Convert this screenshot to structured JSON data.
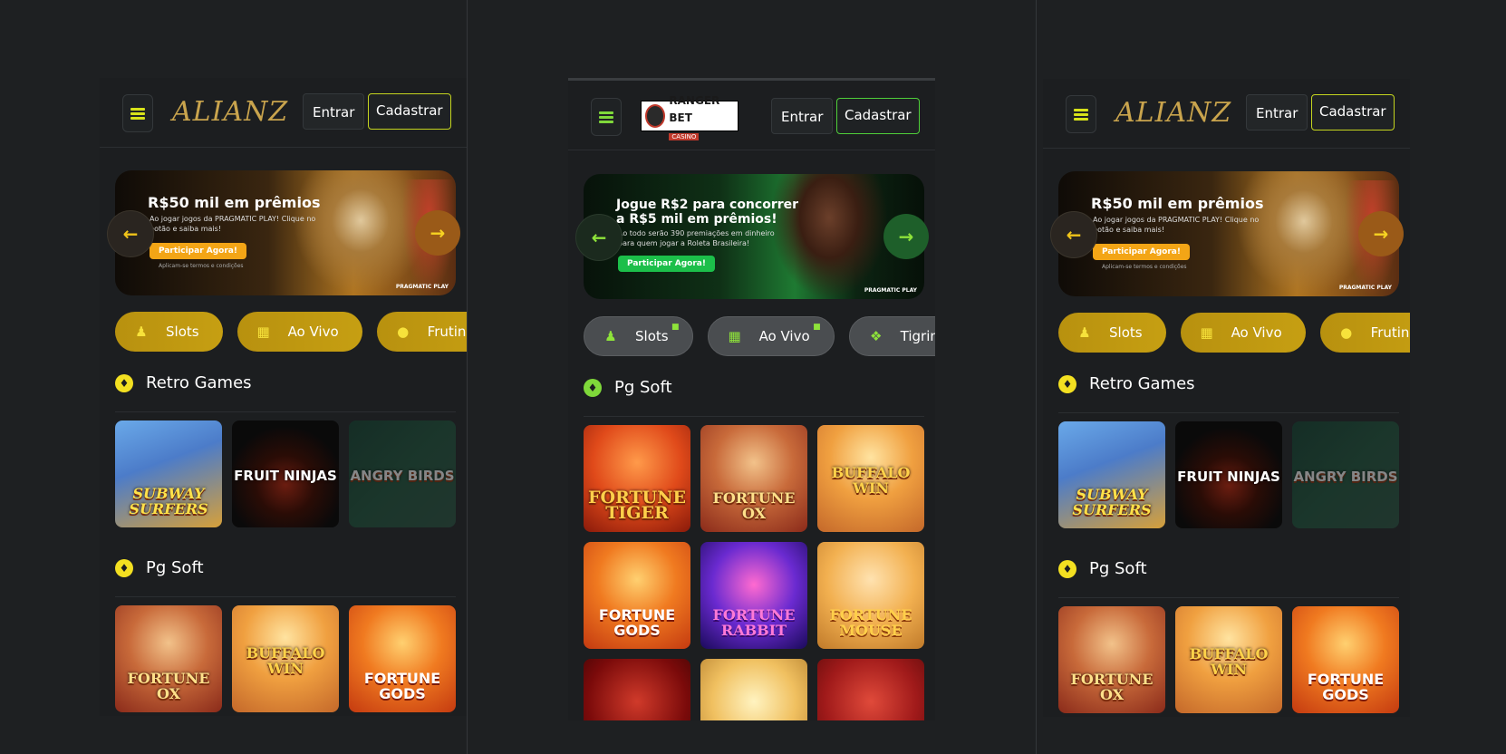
{
  "colors": {
    "bg": "#1e2022",
    "accent_gold": "#d7e21a",
    "accent_green": "#8ee33a",
    "cat_gold": "#c69f12"
  },
  "screens": {
    "left": {
      "logo": "ALIANZ",
      "header": {
        "login": "Entrar",
        "register": "Cadastrar"
      },
      "banner": {
        "title": "R$50 mil em prêmios",
        "subtitle": "Ao jogar jogos da PRAGMATIC PLAY! Clique no botão e saiba mais!",
        "cta": "Participar Agora!",
        "terms": "Aplicam-se termos e condições",
        "brand": "PRAGMATIC PLAY"
      },
      "categories": [
        "Slots",
        "Ao Vivo",
        "Frutin"
      ],
      "sections": [
        {
          "title": "Retro Games",
          "games": [
            "SUBWAY SURFERS",
            "FRUIT NINJAS",
            "ANGRY BIRDS"
          ]
        },
        {
          "title": "Pg Soft",
          "games": [
            "FORTUNE OX",
            "BUFFALO WIN",
            "FORTUNE GODS"
          ]
        }
      ]
    },
    "middle": {
      "logo": "RANGER BET",
      "logo_sub": "CASINO",
      "header": {
        "login": "Entrar",
        "register": "Cadastrar"
      },
      "banner": {
        "title": "Jogue R$2 para concorrer a R$5 mil em prêmios!",
        "subtitle": "Ao todo serão 390 premiações em dinheiro para quem jogar a Roleta Brasileira!",
        "cta": "Participar Agora!",
        "brand": "PRAGMATIC PLAY"
      },
      "categories": [
        "Slots",
        "Ao Vivo",
        "Tigrin"
      ],
      "section_title": "Pg Soft",
      "games": [
        "FORTUNE TIGER",
        "FORTUNE OX",
        "BUFFALO WIN",
        "FORTUNE GODS",
        "FORTUNE RABBIT",
        "FORTUNE MOUSE",
        "",
        "",
        ""
      ]
    },
    "right": {
      "logo": "ALIANZ",
      "header": {
        "login": "Entrar",
        "register": "Cadastrar"
      },
      "banner": {
        "title": "R$50 mil em prêmios",
        "subtitle": "Ao jogar jogos da PRAGMATIC PLAY! Clique no botão e saiba mais!",
        "cta": "Participar Agora!",
        "terms": "Aplicam-se termos e condições",
        "brand": "PRAGMATIC PLAY"
      },
      "categories": [
        "Slots",
        "Ao Vivo",
        "Frutin"
      ],
      "sections": [
        {
          "title": "Retro Games",
          "games": [
            "SUBWAY SURFERS",
            "FRUIT NINJAS",
            "ANGRY BIRDS"
          ]
        },
        {
          "title": "Pg Soft",
          "games": [
            "FORTUNE OX",
            "BUFFALO WIN",
            "FORTUNE GODS"
          ]
        }
      ]
    }
  }
}
